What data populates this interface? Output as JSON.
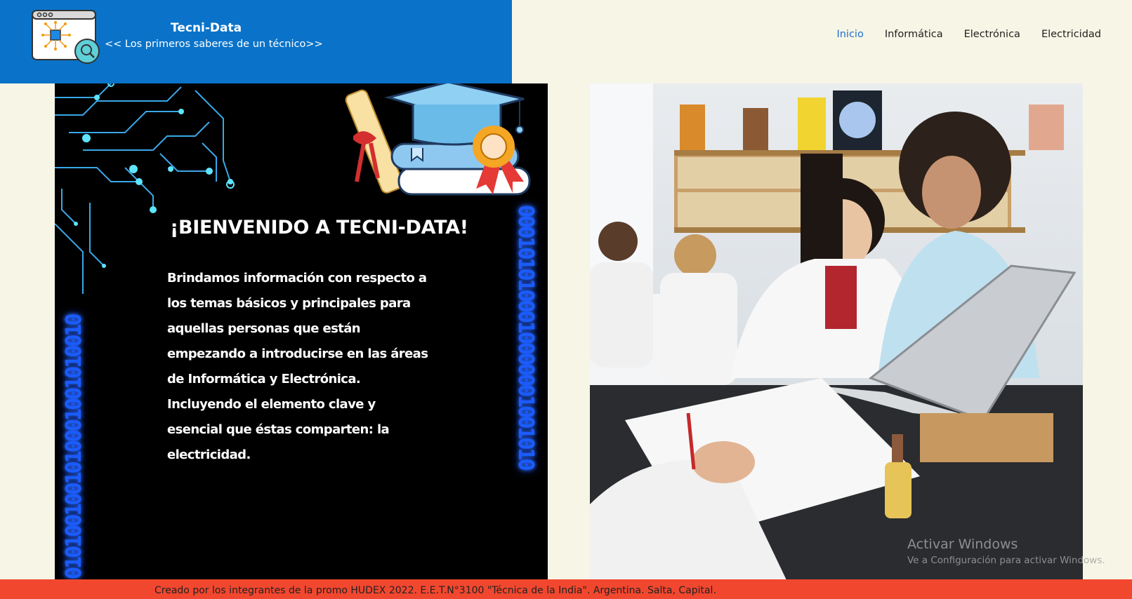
{
  "header": {
    "site_title": "Tecni-Data",
    "tagline": "<< Los primeros saberes de un técnico>>",
    "logo_icon": "browser-chip-magnifier-icon",
    "brand_color": "#0a73c9"
  },
  "nav": {
    "items": [
      {
        "label": "Inicio",
        "active": true
      },
      {
        "label": "Informática",
        "active": false
      },
      {
        "label": "Electrónica",
        "active": false
      },
      {
        "label": "Electricidad",
        "active": false
      }
    ],
    "active_color": "#1d6fd1"
  },
  "welcome": {
    "title": "¡BIENVENIDO A TECNI-DATA!",
    "body": "Brindamos información con respecto a los temas básicos y principales para aquellas personas que están empezando a introducirse en las áreas de Informática y Electrónica. Incluyendo el elemento clave y esencial que éstas comparten: la electricidad.",
    "binary_left": "0101001001010001001010010",
    "binary_right": "0001010100010000001001010",
    "icons": [
      "circuit-icon",
      "diploma-scroll-icon",
      "graduation-cap-icon",
      "books-icon",
      "award-ribbon-icon"
    ]
  },
  "photo": {
    "subject": "students-laptop-lab-photo"
  },
  "watermark": {
    "line1": "Activar Windows",
    "line2": "Ve a Configuración para activar Windows."
  },
  "footer": {
    "text": "Creado por los integrantes de la promo HUDEX 2022. E.E.T.N°3100 \"Técnica de la India\". Argentina. Salta, Capital.",
    "color": "#f2472f"
  }
}
